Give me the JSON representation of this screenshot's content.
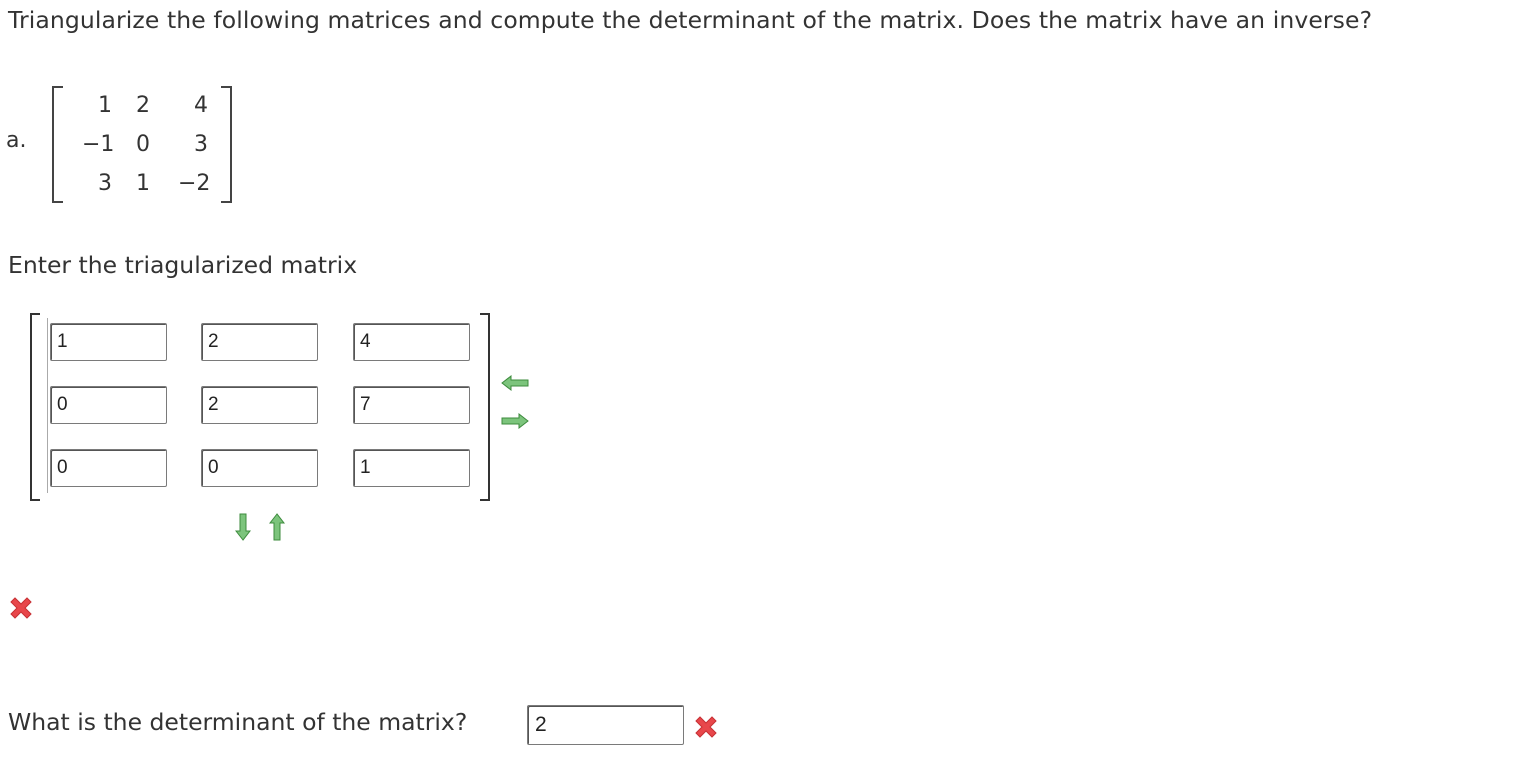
{
  "question": "Triangularize the following matrices and compute the determinant of the matrix. Does the matrix have an inverse?",
  "part": {
    "label": "a.",
    "matrix": [
      [
        "1",
        "2",
        "4"
      ],
      [
        "−1",
        "0",
        "3"
      ],
      [
        "3",
        "1",
        "−2"
      ]
    ]
  },
  "answer": {
    "prompt": "Enter the triagularized matrix",
    "matrix": [
      [
        "1",
        "2",
        "4"
      ],
      [
        "0",
        "2",
        "7"
      ],
      [
        "0",
        "0",
        "1"
      ]
    ],
    "controls": {
      "remove_column_icon": "arrow-left-icon",
      "add_column_icon": "arrow-right-icon",
      "add_row_icon": "arrow-down-icon",
      "remove_row_icon": "arrow-up-icon",
      "arrow_color": "#5cb85c"
    },
    "status_icon": "incorrect-icon",
    "status_color": "#e8474b"
  },
  "determinant": {
    "label": "What is the determinant of the matrix?",
    "value": "2",
    "status_icon": "incorrect-icon"
  }
}
